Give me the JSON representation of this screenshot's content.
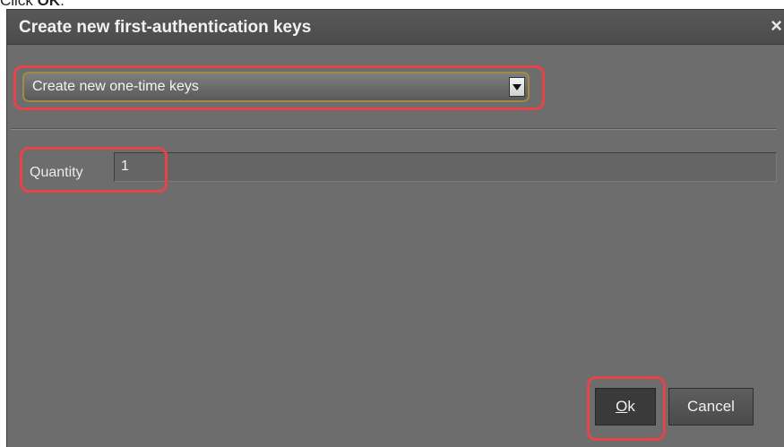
{
  "instruction": {
    "prefix": "Click ",
    "target": "OK",
    "suffix": "."
  },
  "dialog": {
    "title": "Create new first-authentication keys",
    "close_glyph": "×",
    "mode_select": {
      "selected": "Create new one-time keys"
    },
    "quantity": {
      "label": "Quantity",
      "value": "1"
    },
    "buttons": {
      "ok_mnemonic": "O",
      "ok_rest": "k",
      "cancel": "Cancel"
    }
  },
  "highlight_color": "#e8434a",
  "icons": [
    "close-icon",
    "dropdown-arrow-icon"
  ]
}
